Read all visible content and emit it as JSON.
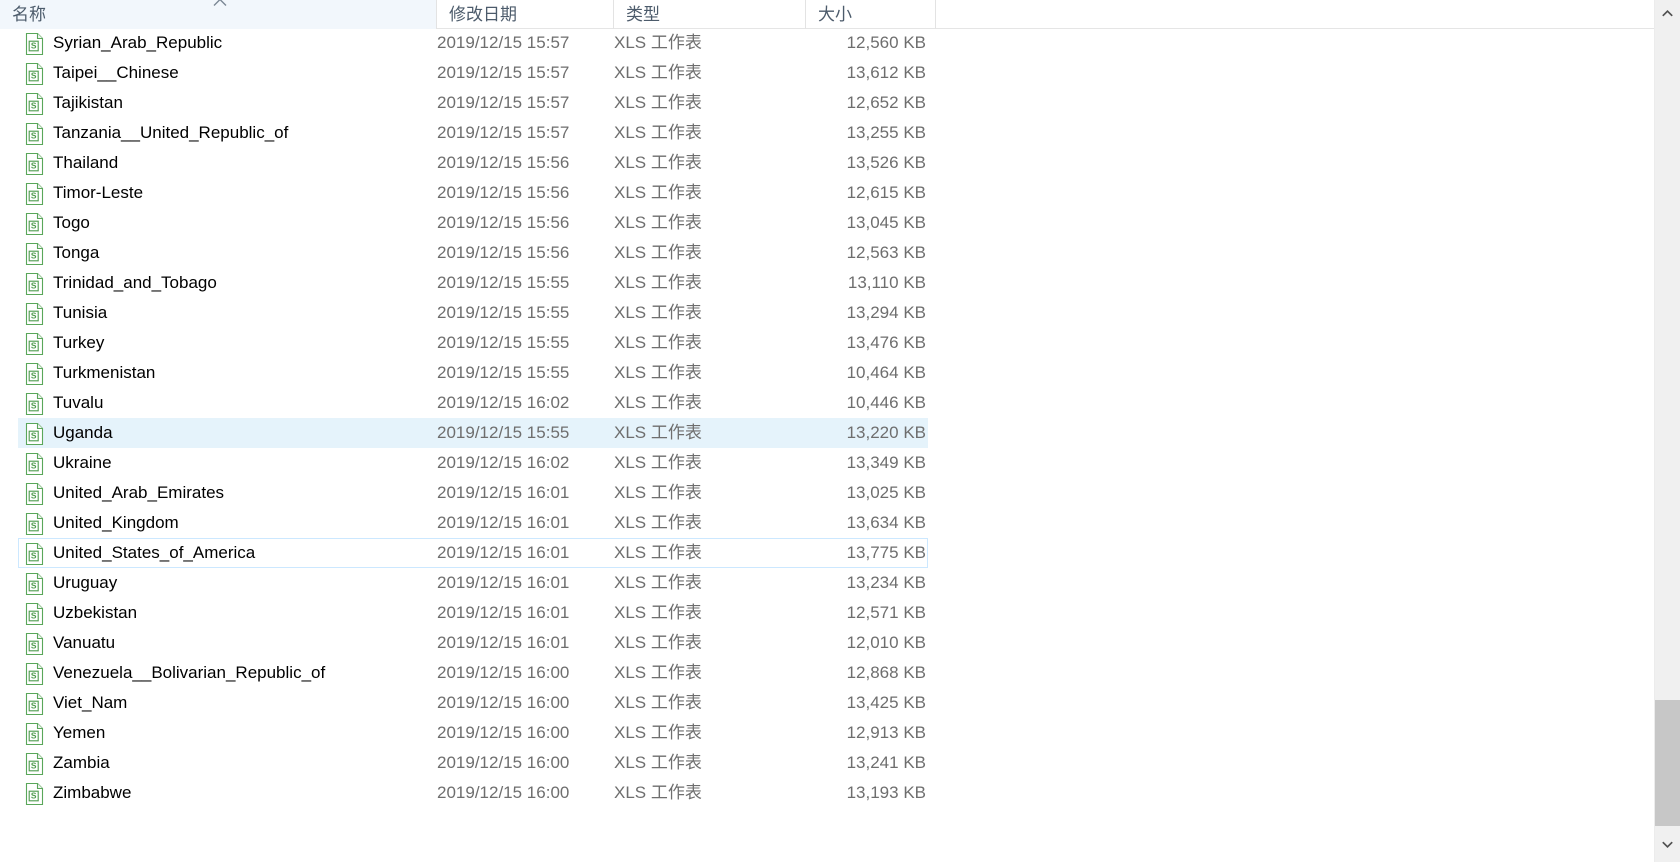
{
  "window": {
    "title": "File Explorer - Details view"
  },
  "columns": {
    "name": "名称",
    "date_modified": "修改日期",
    "type": "类型",
    "size": "大小",
    "sort_column": "名称",
    "sort_direction": "ascending",
    "sort_icon": "chevron-up-icon"
  },
  "colors": {
    "selection": "#cce8ff",
    "hover": "#e5f3fb",
    "focus_border": "#cce8ff",
    "header_text": "#4c5b6b",
    "secondary_text": "#6e6e6e",
    "icon_green": "#4e9a4e",
    "scrollbar_thumb": "#c7c7c7",
    "scrollbar_track": "#f0f0f0"
  },
  "icons": {
    "file": "xls-worksheet-icon",
    "scroll_up": "chevron-up-icon",
    "scroll_down": "chevron-down-icon"
  },
  "files": [
    {
      "name": "Syrian_Arab_Republic",
      "date": "2019/12/15 15:57",
      "type": "XLS 工作表",
      "size": "12,560 KB",
      "state": "clipped"
    },
    {
      "name": "Taipei__Chinese",
      "date": "2019/12/15 15:57",
      "type": "XLS 工作表",
      "size": "13,612 KB",
      "state": "normal"
    },
    {
      "name": "Tajikistan",
      "date": "2019/12/15 15:57",
      "type": "XLS 工作表",
      "size": "12,652 KB",
      "state": "normal"
    },
    {
      "name": "Tanzania__United_Republic_of",
      "date": "2019/12/15 15:57",
      "type": "XLS 工作表",
      "size": "13,255 KB",
      "state": "normal"
    },
    {
      "name": "Thailand",
      "date": "2019/12/15 15:56",
      "type": "XLS 工作表",
      "size": "13,526 KB",
      "state": "normal"
    },
    {
      "name": "Timor-Leste",
      "date": "2019/12/15 15:56",
      "type": "XLS 工作表",
      "size": "12,615 KB",
      "state": "normal"
    },
    {
      "name": "Togo",
      "date": "2019/12/15 15:56",
      "type": "XLS 工作表",
      "size": "13,045 KB",
      "state": "normal"
    },
    {
      "name": "Tonga",
      "date": "2019/12/15 15:56",
      "type": "XLS 工作表",
      "size": "12,563 KB",
      "state": "normal"
    },
    {
      "name": "Trinidad_and_Tobago",
      "date": "2019/12/15 15:55",
      "type": "XLS 工作表",
      "size": "13,110 KB",
      "state": "normal"
    },
    {
      "name": "Tunisia",
      "date": "2019/12/15 15:55",
      "type": "XLS 工作表",
      "size": "13,294 KB",
      "state": "normal"
    },
    {
      "name": "Turkey",
      "date": "2019/12/15 15:55",
      "type": "XLS 工作表",
      "size": "13,476 KB",
      "state": "normal"
    },
    {
      "name": "Turkmenistan",
      "date": "2019/12/15 15:55",
      "type": "XLS 工作表",
      "size": "10,464 KB",
      "state": "normal"
    },
    {
      "name": "Tuvalu",
      "date": "2019/12/15 16:02",
      "type": "XLS 工作表",
      "size": "10,446 KB",
      "state": "normal"
    },
    {
      "name": "Uganda",
      "date": "2019/12/15 15:55",
      "type": "XLS 工作表",
      "size": "13,220 KB",
      "state": "hover"
    },
    {
      "name": "Ukraine",
      "date": "2019/12/15 16:02",
      "type": "XLS 工作表",
      "size": "13,349 KB",
      "state": "normal"
    },
    {
      "name": "United_Arab_Emirates",
      "date": "2019/12/15 16:01",
      "type": "XLS 工作表",
      "size": "13,025 KB",
      "state": "normal"
    },
    {
      "name": "United_Kingdom",
      "date": "2019/12/15 16:01",
      "type": "XLS 工作表",
      "size": "13,634 KB",
      "state": "normal"
    },
    {
      "name": "United_States_of_America",
      "date": "2019/12/15 16:01",
      "type": "XLS 工作表",
      "size": "13,775 KB",
      "state": "focus"
    },
    {
      "name": "Uruguay",
      "date": "2019/12/15 16:01",
      "type": "XLS 工作表",
      "size": "13,234 KB",
      "state": "normal"
    },
    {
      "name": "Uzbekistan",
      "date": "2019/12/15 16:01",
      "type": "XLS 工作表",
      "size": "12,571 KB",
      "state": "normal"
    },
    {
      "name": "Vanuatu",
      "date": "2019/12/15 16:01",
      "type": "XLS 工作表",
      "size": "12,010 KB",
      "state": "normal"
    },
    {
      "name": "Venezuela__Bolivarian_Republic_of",
      "date": "2019/12/15 16:00",
      "type": "XLS 工作表",
      "size": "12,868 KB",
      "state": "normal"
    },
    {
      "name": "Viet_Nam",
      "date": "2019/12/15 16:00",
      "type": "XLS 工作表",
      "size": "13,425 KB",
      "state": "normal"
    },
    {
      "name": "Yemen",
      "date": "2019/12/15 16:00",
      "type": "XLS 工作表",
      "size": "12,913 KB",
      "state": "normal"
    },
    {
      "name": "Zambia",
      "date": "2019/12/15 16:00",
      "type": "XLS 工作表",
      "size": "13,241 KB",
      "state": "normal"
    },
    {
      "name": "Zimbabwe",
      "date": "2019/12/15 16:00",
      "type": "XLS 工作表",
      "size": "13,193 KB",
      "state": "normal"
    }
  ]
}
